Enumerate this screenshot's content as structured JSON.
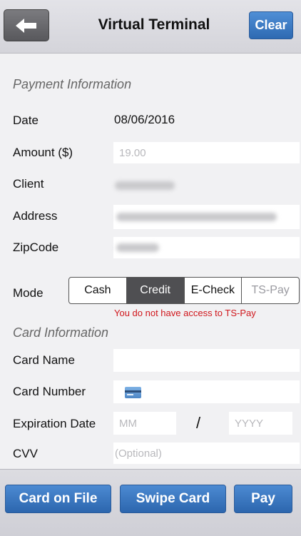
{
  "header": {
    "title": "Virtual Terminal",
    "back_icon": "arrow-left-icon",
    "clear_label": "Clear"
  },
  "payment": {
    "section_title": "Payment Information",
    "date_label": "Date",
    "date_value": "08/06/2016",
    "amount_label": "Amount ($)",
    "amount_value": "19.00",
    "client_label": "Client",
    "address_label": "Address",
    "zip_label": "ZipCode",
    "mode_label": "Mode",
    "modes": [
      "Cash",
      "Credit",
      "E-Check",
      "TS-Pay"
    ],
    "selected_mode": "Credit",
    "mode_error": "You do not have access to TS-Pay"
  },
  "card": {
    "section_title": "Card Information",
    "name_label": "Card Name",
    "number_label": "Card Number",
    "card_icon": "credit-card-icon",
    "expiration_label": "Expiration Date",
    "month_placeholder": "MM",
    "separator": "/",
    "year_placeholder": "YYYY",
    "cvv_label": "CVV",
    "cvv_placeholder": "(Optional)"
  },
  "footer": {
    "card_on_file_label": "Card on File",
    "swipe_card_label": "Swipe Card",
    "pay_label": "Pay"
  },
  "colors": {
    "accent_blue": "#3b7bc6",
    "selected_segment": "#4f4f52",
    "error_red": "#d0161b"
  }
}
